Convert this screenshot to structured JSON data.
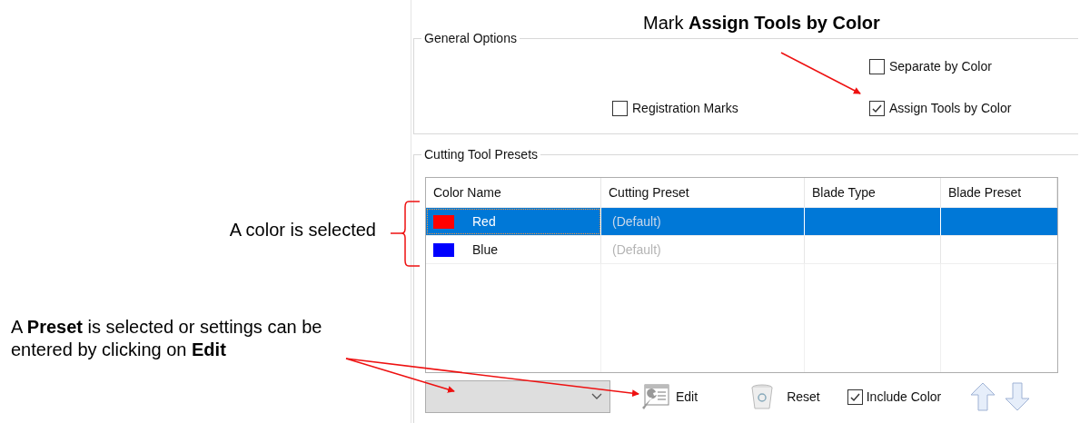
{
  "annotations": {
    "top": "Mark **Assign Tools by Color**",
    "brace": "A color is selected",
    "bottom": "A **Preset** is selected or settings can be entered by clicking on **Edit**"
  },
  "general_options": {
    "title": "General Options",
    "checkboxes": [
      {
        "label": "Separate by Color",
        "checked": false
      },
      {
        "label": "Registration Marks",
        "checked": false
      },
      {
        "label": "Assign Tools by Color",
        "checked": true
      }
    ]
  },
  "cutting_tool_presets": {
    "title": "Cutting Tool Presets",
    "columns": [
      "Color Name",
      "Cutting Preset",
      "Blade Type",
      "Blade Preset"
    ],
    "rows": [
      {
        "color": "#ff0000",
        "name": "Red",
        "cutting_preset": "(Default)",
        "selected": true
      },
      {
        "color": "#0000ff",
        "name": "Blue",
        "cutting_preset": "(Default)",
        "selected": false
      }
    ]
  },
  "toolbar": {
    "edit": "Edit",
    "reset": "Reset",
    "include_color": {
      "label": "Include Color",
      "checked": true
    }
  }
}
